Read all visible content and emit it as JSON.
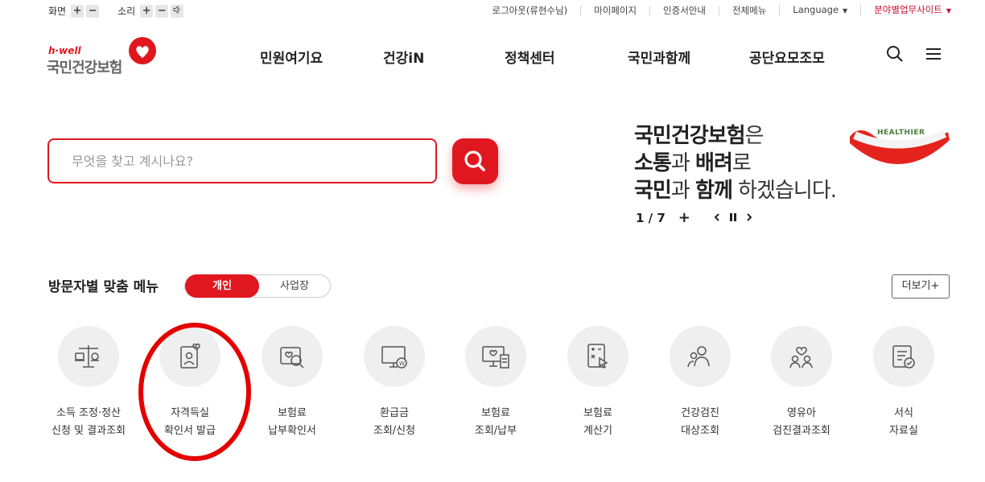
{
  "utility": {
    "screen_label": "화면",
    "sound_label": "소리",
    "plus": "+",
    "minus": "−",
    "links": [
      "로그아웃(류현수님)",
      "마이페이지",
      "인증서안내",
      "전체메뉴",
      "Language",
      "분야별업무사이트"
    ]
  },
  "logo": {
    "hwell": "h·well",
    "name": "국민건강보험"
  },
  "gnb": [
    "민원여기요",
    "건강iN",
    "정책센터",
    "국민과함께",
    "공단요모조모"
  ],
  "search": {
    "placeholder": "무엇을 찾고 계시나요?"
  },
  "banner": {
    "l1_b": "국민건강보험",
    "l1_r": "은",
    "l2_b1": "소통",
    "l2_r1": "과 ",
    "l2_b2": "배려",
    "l2_r2": "로",
    "l3_b1": "국민",
    "l3_r1": "과 ",
    "l3_b2": "함께",
    "l3_r2": " 하겠습니다.",
    "badge": "HEALTHIER",
    "counter": "1 / 7"
  },
  "visitor_menu": {
    "title": "방문자별 맞춤 메뉴",
    "tab_personal": "개인",
    "tab_business": "사업장",
    "more": "더보기+",
    "items": [
      {
        "l1": "소득 조정·정산",
        "l2": "신청 및 결과조회",
        "icon": "scale-icon"
      },
      {
        "l1": "자격득실",
        "l2": "확인서 발급",
        "icon": "id-card-heart-icon"
      },
      {
        "l1": "보험료",
        "l2": "납부확인서",
        "icon": "document-search-icon"
      },
      {
        "l1": "환급금",
        "l2": "조회/신청",
        "icon": "monitor-won-icon"
      },
      {
        "l1": "보험료",
        "l2": "조회/납부",
        "icon": "screen-receipt-icon"
      },
      {
        "l1": "보험료",
        "l2": "계산기",
        "icon": "calculator-icon"
      },
      {
        "l1": "건강검진",
        "l2": "대상조회",
        "icon": "people-icon"
      },
      {
        "l1": "영유아",
        "l2": "검진결과조회",
        "icon": "family-heart-icon"
      },
      {
        "l1": "서식",
        "l2": "자료실",
        "icon": "form-check-icon"
      }
    ]
  },
  "colors": {
    "brand_red": "#e0171f",
    "annotation_red": "#e40000"
  }
}
